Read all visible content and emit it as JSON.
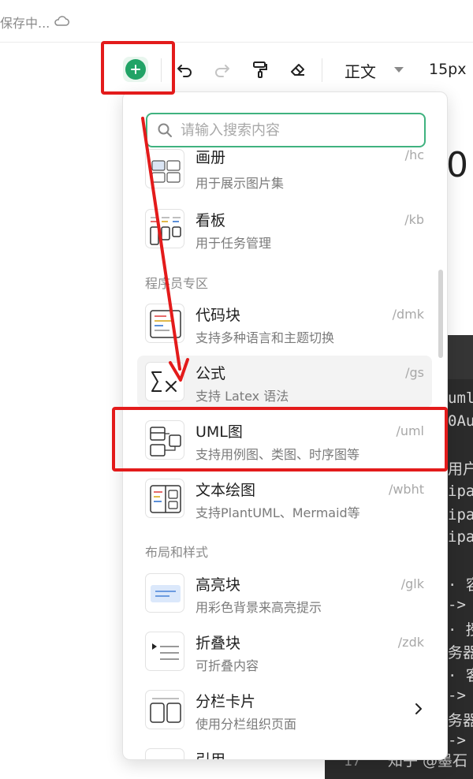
{
  "status": {
    "save_text": "保存中...",
    "cloud_icon": "cloud-icon"
  },
  "toolbar": {
    "add_icon": "plus-circle-icon",
    "undo_icon": "undo-icon",
    "redo_icon": "redo-icon",
    "format_painter_icon": "format-painter-icon",
    "eraser_icon": "eraser-icon",
    "text_style": "正文",
    "font_size": "15px"
  },
  "background": {
    "heading_fragment": "0",
    "code_lines": [
      "uml",
      "0Au",
      "用户",
      "ipa",
      "ipa",
      "ipa",
      "· 容",
      "->",
      "· 授",
      "务器",
      "· 客",
      "->",
      "务器",
      "->"
    ],
    "line_number": "17",
    "watermark": "知乎 @墨石"
  },
  "menu": {
    "search_placeholder": "请输入搜索内容",
    "groups": [
      {
        "title": ""
      },
      {
        "title": "程序员专区"
      },
      {
        "title": "布局和样式"
      }
    ],
    "items": [
      {
        "title": "画册",
        "desc": "用于展示图片集",
        "cmd": "/hc"
      },
      {
        "title": "看板",
        "desc": "用于任务管理",
        "cmd": "/kb"
      },
      {
        "title": "代码块",
        "desc": "支持多种语言和主题切换",
        "cmd": "/dmk"
      },
      {
        "title": "公式",
        "desc": "支持 Latex 语法",
        "cmd": "/gs"
      },
      {
        "title": "UML图",
        "desc": "支持用例图、类图、时序图等",
        "cmd": "/uml"
      },
      {
        "title": "文本绘图",
        "desc": "支持PlantUML、Mermaid等",
        "cmd": "/wbht"
      },
      {
        "title": "高亮块",
        "desc": "用彩色背景来高亮提示",
        "cmd": "/glk"
      },
      {
        "title": "折叠块",
        "desc": "可折叠内容",
        "cmd": "/zdk"
      },
      {
        "title": "分栏卡片",
        "desc": "使用分栏组织页面",
        "cmd": ""
      },
      {
        "title": "引用",
        "desc": "",
        "cmd": ""
      }
    ]
  },
  "colors": {
    "accent": "#21a366",
    "annotation": "#e31b1b",
    "search_border": "#3fb27f"
  }
}
